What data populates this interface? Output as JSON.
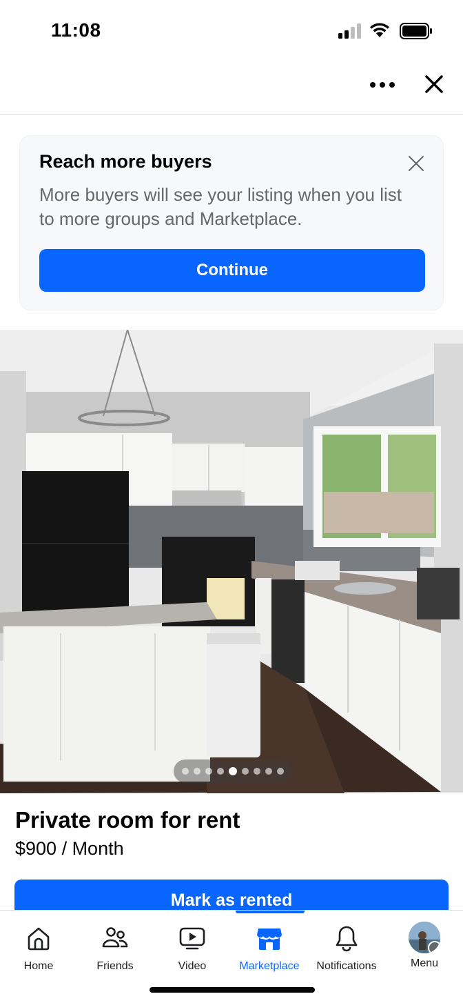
{
  "status_bar": {
    "time": "11:08"
  },
  "top_nav": {
    "more_icon": "more-horizontal-icon",
    "close_icon": "close-icon"
  },
  "promo": {
    "title": "Reach more buyers",
    "body": "More buyers will see your listing when you list to more groups and Marketplace.",
    "cta_label": "Continue",
    "dismiss_icon": "close-icon"
  },
  "listing": {
    "photo_count": 9,
    "active_photo_index": 4,
    "title": "Private room for rent",
    "price": "$900 / Month",
    "primary_action": "Mark as rented"
  },
  "tab_bar": {
    "active": "Marketplace",
    "tabs": [
      {
        "label": "Home",
        "icon": "home-icon"
      },
      {
        "label": "Friends",
        "icon": "friends-icon"
      },
      {
        "label": "Video",
        "icon": "video-icon"
      },
      {
        "label": "Marketplace",
        "icon": "marketplace-icon"
      },
      {
        "label": "Notifications",
        "icon": "bell-icon"
      },
      {
        "label": "Menu",
        "icon": "avatar"
      }
    ]
  },
  "colors": {
    "accent": "#0866ff",
    "text_primary": "#050505",
    "text_secondary": "#65676b",
    "card_bg": "#f7f8fa"
  }
}
